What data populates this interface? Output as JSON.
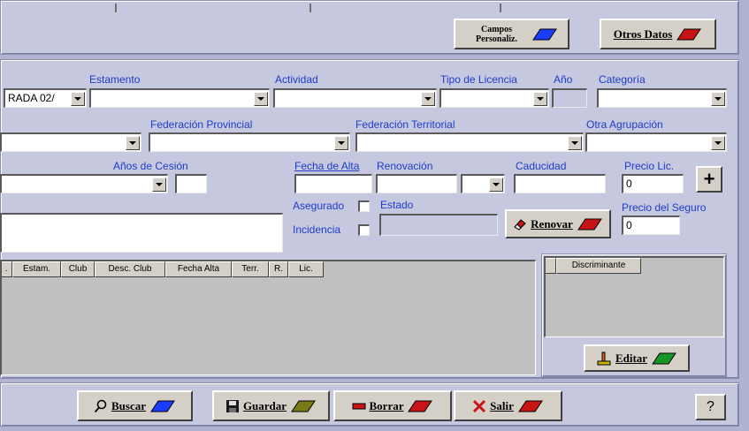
{
  "top": {
    "campos_label": "Campos Personaliz.",
    "otros_label": "Otros Datos"
  },
  "labels": {
    "estamento": "Estamento",
    "actividad": "Actividad",
    "tipo_licencia": "Tipo de Licencia",
    "anio": "Año",
    "categoria": "Categoría",
    "fed_provincial": "Federación Provincial",
    "fed_territorial": "Federación Territorial",
    "otra_agrupacion": "Otra Agrupación",
    "anios_cesion": "Años de Cesión",
    "fecha_alta": "Fecha de Alta",
    "renovacion": "Renovación",
    "caducidad": "Caducidad",
    "precio_lic": "Precio Lic.",
    "asegurado": "Asegurado",
    "estado": "Estado",
    "incidencia": "Incidencia",
    "precio_seguro": "Precio del Seguro"
  },
  "values": {
    "first_combo": "RADA 02/",
    "precio_lic": "0",
    "precio_seguro": "0"
  },
  "buttons": {
    "plus": "+",
    "renovar": "Renovar",
    "editar": "Editar",
    "buscar": "Buscar",
    "guardar": "Guardar",
    "borrar": "Borrar",
    "salir": "Salir",
    "help": "?"
  },
  "grid": {
    "columns": [
      ".",
      "Estam.",
      "Club",
      "Desc. Club",
      "Fecha Alta",
      "Terr.",
      "R.",
      "Lic."
    ]
  },
  "side_grid": {
    "columns": [
      "",
      "Discriminante"
    ]
  },
  "colors": {
    "accent_blue": "#1e3cc8",
    "pen_blue": "#1a3cff",
    "pen_red": "#c81414",
    "pen_green": "#149628",
    "pen_olive": "#7a7a14"
  }
}
